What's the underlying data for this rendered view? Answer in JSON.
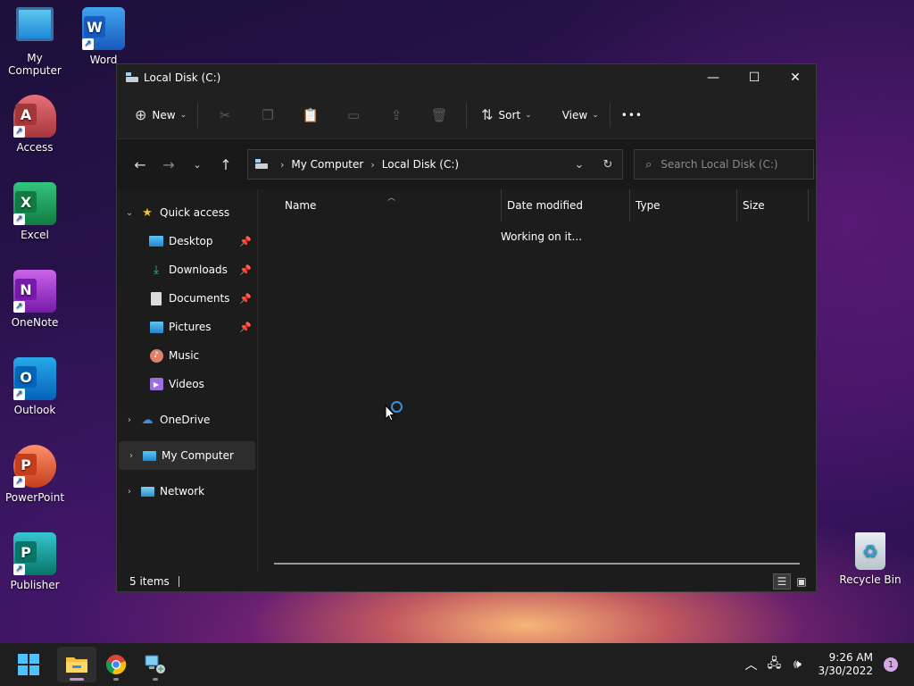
{
  "desktop": {
    "icons": [
      {
        "label": "My Computer"
      },
      {
        "label": "Word"
      },
      {
        "label": "Access"
      },
      {
        "label": "Excel"
      },
      {
        "label": "OneNote"
      },
      {
        "label": "Outlook"
      },
      {
        "label": "PowerPoint"
      },
      {
        "label": "Publisher"
      },
      {
        "label": "Recycle Bin"
      }
    ]
  },
  "window": {
    "title": "Local Disk (C:)",
    "toolbar": {
      "new_label": "New",
      "sort_label": "Sort",
      "view_label": "View",
      "more_label": "•••"
    },
    "address": {
      "crumbs": [
        "My Computer",
        "Local Disk (C:)"
      ]
    },
    "search": {
      "placeholder": "Search Local Disk (C:)"
    },
    "sidebar": {
      "quick_access": "Quick access",
      "items": [
        {
          "label": "Desktop"
        },
        {
          "label": "Downloads"
        },
        {
          "label": "Documents"
        },
        {
          "label": "Pictures"
        },
        {
          "label": "Music"
        },
        {
          "label": "Videos"
        }
      ],
      "onedrive": "OneDrive",
      "my_computer": "My Computer",
      "network": "Network"
    },
    "columns": {
      "name": "Name",
      "date_modified": "Date modified",
      "type": "Type",
      "size": "Size"
    },
    "status_message": "Working on it...",
    "status_bar": {
      "items_count": "5 items"
    }
  },
  "taskbar": {
    "time": "9:26 AM",
    "date": "3/30/2022",
    "notification_count": "1"
  },
  "colors": {
    "accent": "#3b8de0",
    "window_bg": "#1c1c1c",
    "taskbar_bg": "#1e1e1e"
  }
}
